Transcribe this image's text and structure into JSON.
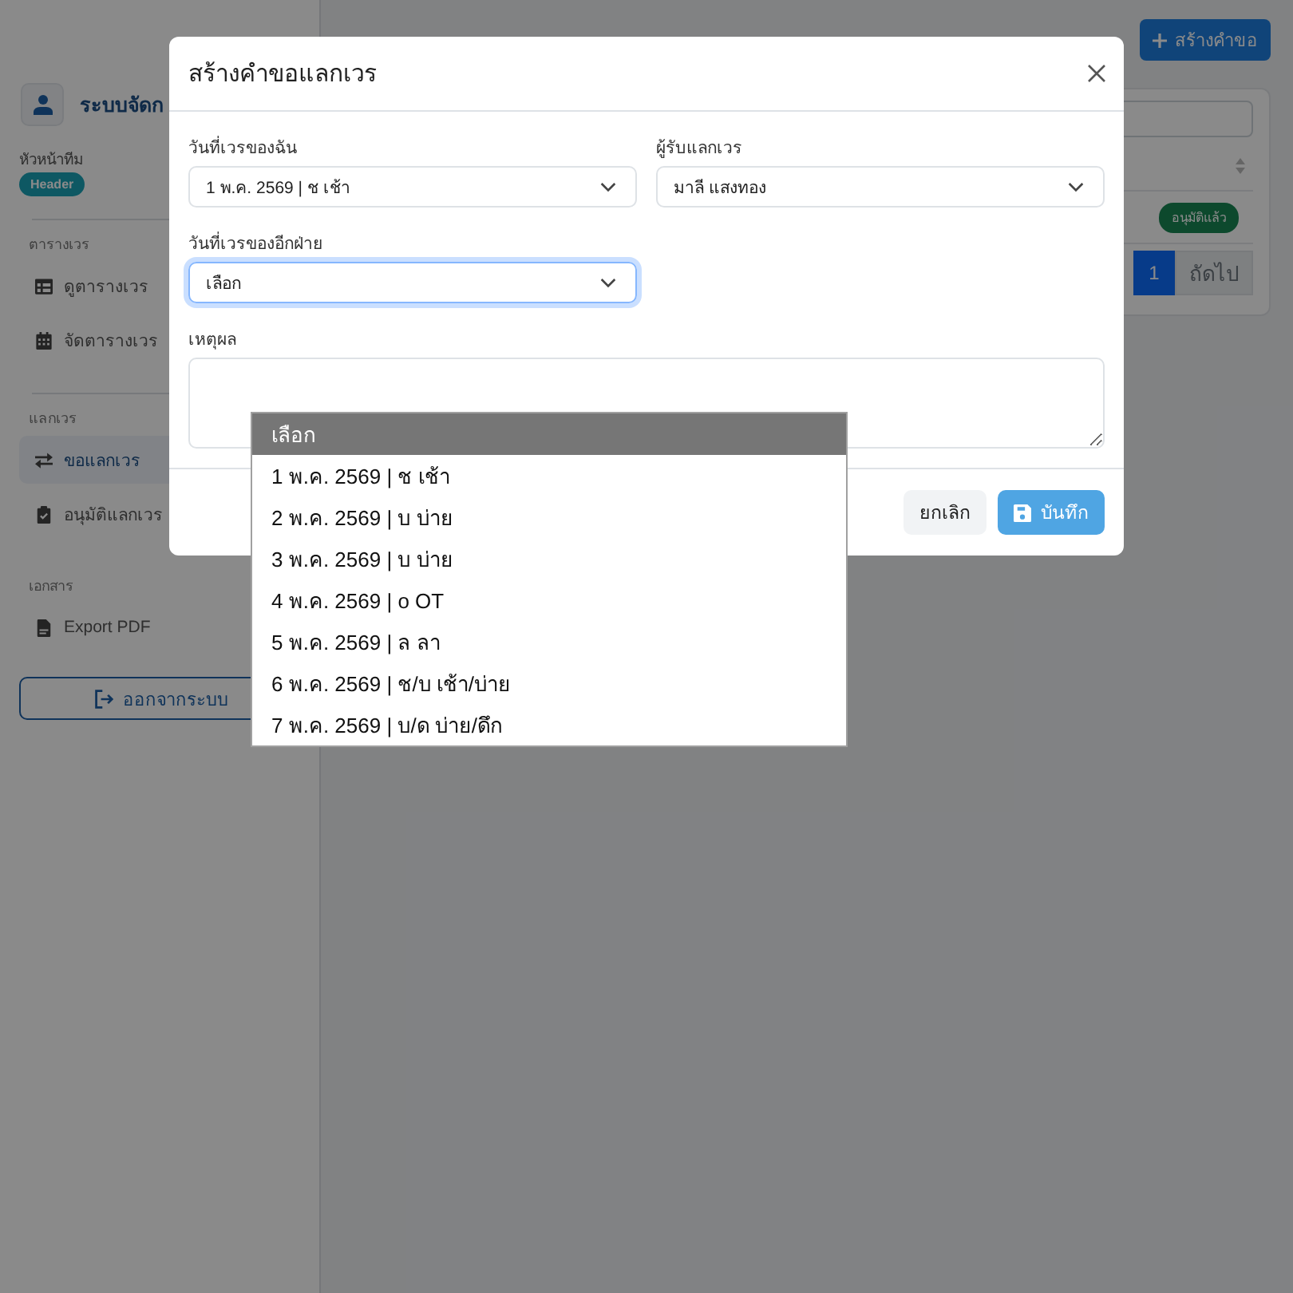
{
  "sidebar": {
    "brand": "ระบบจัดก",
    "role_label": "หัวหน้าทีม",
    "role_badge": "Header",
    "sections": [
      {
        "title": "ตารางเวร",
        "items": [
          {
            "label": "ดูตารางเวร",
            "selected": false
          },
          {
            "label": "จัดตารางเวร",
            "selected": false
          }
        ]
      },
      {
        "title": "แลกเวร",
        "items": [
          {
            "label": "ขอแลกเวร",
            "selected": true
          },
          {
            "label": "อนุมัติแลกเวร",
            "selected": false
          }
        ]
      },
      {
        "title": "เอกสาร",
        "items": [
          {
            "label": "Export PDF",
            "selected": false
          }
        ]
      }
    ],
    "logout_button": "ออกจากระบบ"
  },
  "main": {
    "create_button": "สร้างคำขอ",
    "table": {
      "rows": [
        {
          "status": "อนุมัติแล้ว"
        }
      ]
    },
    "pagination": {
      "pages": [
        {
          "label": "1",
          "selected": true
        }
      ],
      "next": "ถัดไป"
    }
  },
  "modal": {
    "title": "สร้างคำขอแลกเวร",
    "fields": [
      {
        "kind": "select",
        "label": "วันที่เวรของฉัน",
        "value": "1 พ.ค. 2569 | ช เช้า",
        "focused": false
      },
      {
        "kind": "select",
        "label": "ผู้รับแลกเวร",
        "value": "มาลี แสงทอง",
        "focused": false
      },
      {
        "kind": "select",
        "label": "วันที่เวรของอีกฝ่าย",
        "value": "เลือก",
        "focused": true
      },
      {
        "kind": "textarea",
        "label": "เหตุผล"
      }
    ],
    "buttons": [
      {
        "kind": "secondary",
        "label": "ยกเลิก"
      },
      {
        "kind": "primary",
        "label": "บันทึก"
      }
    ]
  },
  "dropdown": {
    "options": [
      {
        "label": "เลือก",
        "selected": true
      },
      {
        "label": "1 พ.ค. 2569 | ช เช้า",
        "selected": false
      },
      {
        "label": "2 พ.ค. 2569 | บ บ่าย",
        "selected": false
      },
      {
        "label": "3 พ.ค. 2569 | บ บ่าย",
        "selected": false
      },
      {
        "label": "4 พ.ค. 2569 | o OT",
        "selected": false
      },
      {
        "label": "5 พ.ค. 2569 | ล ลา",
        "selected": false
      },
      {
        "label": "6 พ.ค. 2569 | ช/บ เช้า/บ่าย",
        "selected": false
      },
      {
        "label": "7 พ.ค. 2569 | บ/ด บ่าย/ดึก",
        "selected": false
      }
    ]
  }
}
